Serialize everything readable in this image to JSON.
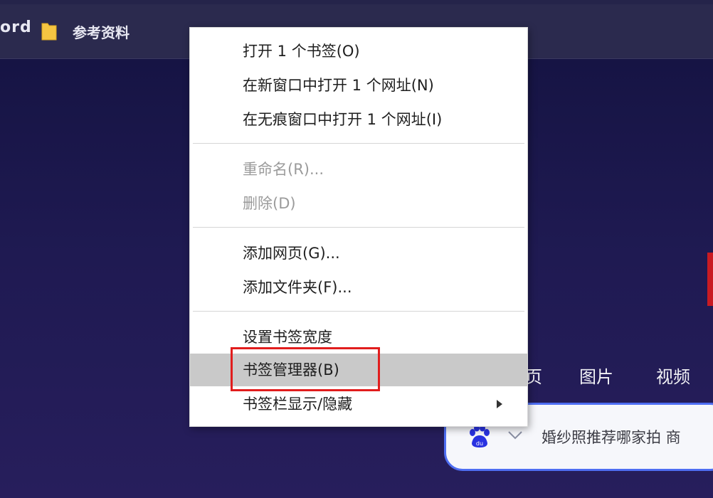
{
  "bookmarks_bar": {
    "partial_label": "ord",
    "folder_label": "参考资料"
  },
  "context_menu": {
    "items": [
      {
        "label": "打开 1 个书签(O)"
      },
      {
        "label": "在新窗口中打开 1 个网址(N)"
      },
      {
        "label": "在无痕窗口中打开 1 个网址(I)"
      },
      {
        "label": "重命名(R)..."
      },
      {
        "label": "删除(D)"
      },
      {
        "label": "添加网页(G)..."
      },
      {
        "label": "添加文件夹(F)..."
      },
      {
        "label": "设置书签宽度"
      },
      {
        "label": "书签管理器(B)"
      },
      {
        "label": "书签栏显示/隐藏"
      }
    ]
  },
  "page_nav": {
    "page_partial": "页",
    "images": "图片",
    "video": "视频"
  },
  "search": {
    "text": "婚纱照推荐哪家拍 商"
  },
  "colors": {
    "highlight_box": "#e11d1d",
    "search_border": "#4e6ef2",
    "folder_icon": "#f5c542"
  }
}
